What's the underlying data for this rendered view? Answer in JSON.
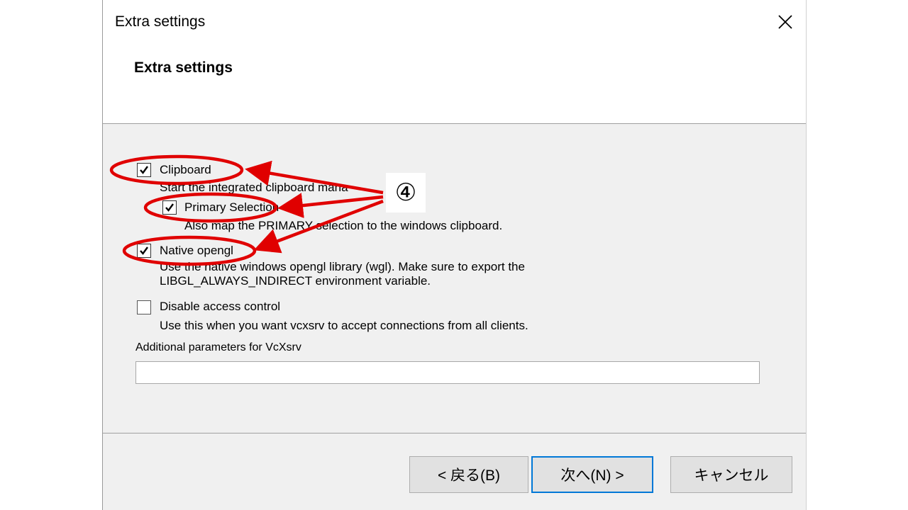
{
  "window": {
    "title": "Extra settings"
  },
  "header": {
    "title": "Extra settings"
  },
  "options": [
    {
      "label": "Clipboard",
      "checked": true,
      "desc": [
        "Start the integrated clipboard mana"
      ]
    },
    {
      "label": "Primary Selection",
      "checked": true,
      "desc": [
        "Also map the PRIMARY selection to the windows clipboard."
      ]
    },
    {
      "label": "Native opengl",
      "checked": true,
      "desc": [
        "Use the native windows opengl library (wgl). Make sure to export the",
        "LIBGL_ALWAYS_INDIRECT environment variable."
      ]
    },
    {
      "label": "Disable access control",
      "checked": false,
      "desc": [
        "Use this when you want vcxsrv to accept connections from all clients."
      ]
    }
  ],
  "params": {
    "label": "Additional parameters for VcXsrv",
    "value": ""
  },
  "buttons": {
    "back": "< 戻る(B)",
    "next": "次へ(N) >",
    "cancel": "キャンセル"
  },
  "annotation": {
    "badge": "④",
    "color": "#e00000"
  }
}
